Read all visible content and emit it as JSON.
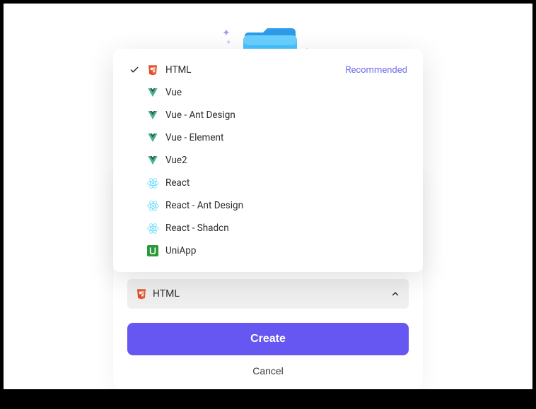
{
  "selected": {
    "label": "HTML",
    "icon": "html5"
  },
  "dropdown": {
    "recommended_badge": "Recommended",
    "options": [
      {
        "label": "HTML",
        "icon": "html5",
        "selected": true,
        "recommended": true
      },
      {
        "label": "Vue",
        "icon": "vue",
        "selected": false,
        "recommended": false
      },
      {
        "label": "Vue - Ant Design",
        "icon": "vue",
        "selected": false,
        "recommended": false
      },
      {
        "label": "Vue - Element",
        "icon": "vue",
        "selected": false,
        "recommended": false
      },
      {
        "label": "Vue2",
        "icon": "vue",
        "selected": false,
        "recommended": false
      },
      {
        "label": "React",
        "icon": "react",
        "selected": false,
        "recommended": false
      },
      {
        "label": "React - Ant Design",
        "icon": "react",
        "selected": false,
        "recommended": false
      },
      {
        "label": "React - Shadcn",
        "icon": "react",
        "selected": false,
        "recommended": false
      },
      {
        "label": "UniApp",
        "icon": "uniapp",
        "selected": false,
        "recommended": false
      }
    ]
  },
  "buttons": {
    "create": "Create",
    "cancel": "Cancel"
  }
}
